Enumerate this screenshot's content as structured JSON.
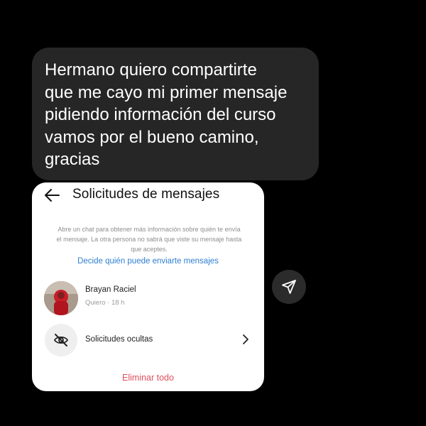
{
  "message": {
    "lines": [
      "Hermano quiero compartirte",
      "que me cayo mi primer mensaje",
      "pidiendo información del curso",
      "vamos por el bueno camino,",
      "gracias"
    ]
  },
  "card": {
    "title": "Solicitudes de mensajes",
    "description_lines": [
      "Abre un chat para obtener más información sobre quién te envía",
      "el mensaje. La otra persona no sabrá que viste su mensaje hasta",
      "que aceptes."
    ],
    "link": "Decide quién puede enviarte mensajes",
    "request": {
      "name": "Brayan Raciel",
      "subtitle": "Quiero · 18 h"
    },
    "hidden_requests_label": "Solicitudes ocultas",
    "delete_all": "Eliminar todo"
  },
  "icons": {
    "back": "back-arrow-icon",
    "hidden": "eye-off-icon",
    "chevron": "chevron-right-icon",
    "send": "send-icon"
  },
  "colors": {
    "background": "#000000",
    "bubble": "#262626",
    "link": "#2e7fd0",
    "danger": "#e0505e"
  }
}
